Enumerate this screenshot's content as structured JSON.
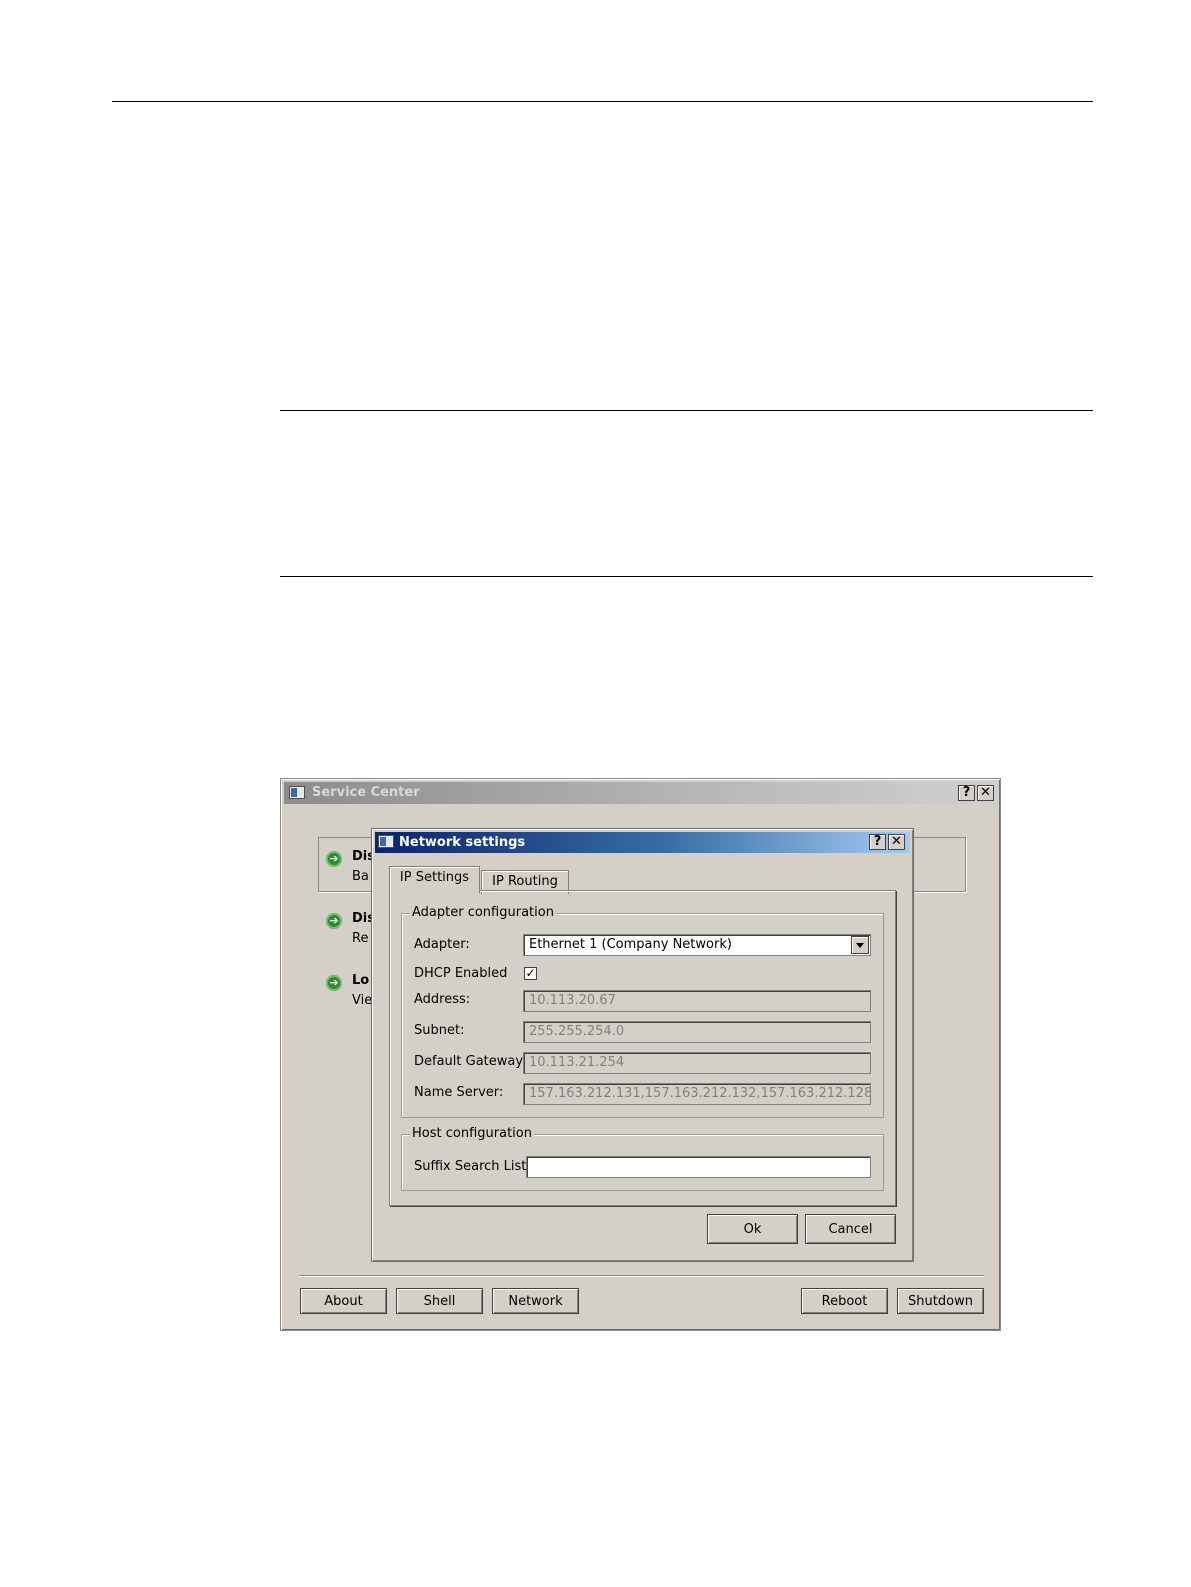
{
  "service_center": {
    "title": "Service Center",
    "help_btn": "?",
    "close_btn": "✕",
    "items": [
      {
        "title": "Dis",
        "subtitle": "Ba"
      },
      {
        "title": "Dis",
        "subtitle": "Re"
      },
      {
        "title": "Lo",
        "subtitle": "Vie"
      }
    ],
    "buttons": {
      "about": "About",
      "shell": "Shell",
      "network": "Network",
      "reboot": "Reboot",
      "shutdown": "Shutdown"
    }
  },
  "network_settings": {
    "title": "Network settings",
    "help_btn": "?",
    "close_btn": "✕",
    "tabs": [
      {
        "label": "IP Settings",
        "active": true
      },
      {
        "label": "IP Routing",
        "active": false
      }
    ],
    "adapter_group": {
      "legend": "Adapter configuration",
      "adapter_label": "Adapter:",
      "adapter_value": "Ethernet 1 (Company Network)",
      "dhcp_label": "DHCP Enabled",
      "dhcp_checked": true,
      "dhcp_mark": "✓",
      "address_label": "Address:",
      "address_value": "10.113.20.67",
      "subnet_label": "Subnet:",
      "subnet_value": "255.255.254.0",
      "gateway_label": "Default Gateway:",
      "gateway_value": "10.113.21.254",
      "nameserver_label": "Name Server:",
      "nameserver_value": "157.163.212.131,157.163.212.132,157.163.212.128"
    },
    "host_group": {
      "legend": "Host configuration",
      "suffix_label": "Suffix Search List:",
      "suffix_value": ""
    },
    "buttons": {
      "ok": "Ok",
      "cancel": "Cancel"
    }
  }
}
